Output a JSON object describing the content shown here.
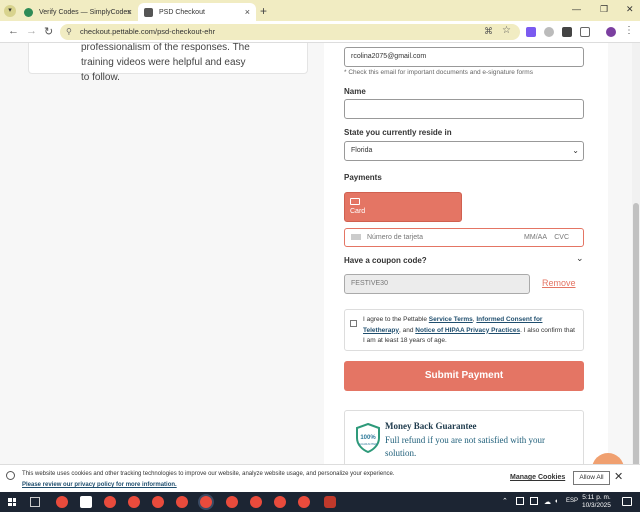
{
  "browser": {
    "tabs": [
      {
        "title": "Verify Codes — SimplyCodes",
        "favicon_color": "#2e8b57"
      },
      {
        "title": "PSD Checkout",
        "favicon_color": "#555555"
      }
    ],
    "url": "checkout.pettable.com/psd-checkout-ehr",
    "newtab_glyph": "+",
    "close_glyph": "×",
    "icons": [
      "back-icon",
      "forward-icon",
      "reload-icon",
      "translate-icon",
      "star-icon",
      "extensions-icon",
      "profile-icon",
      "menu-icon"
    ]
  },
  "review": {
    "text": "professionalism of the responses. The training videos were helpful and easy to follow."
  },
  "form": {
    "email_value": "rcolina2075@gmail.com",
    "email_note": "* Check this email for important documents and e-signature forms",
    "name_label": "Name",
    "name_value": "",
    "state_label": "State you currently reside in",
    "state_value": "Florida",
    "payments_label": "Payments",
    "card_label": "Card",
    "card_number_placeholder": "Número de tarjeta",
    "card_expiry_placeholder": "MM/AA",
    "card_cvc_placeholder": "CVC",
    "coupon_label": "Have a coupon code?",
    "coupon_value": "FESTIVE30",
    "remove_label": "Remove",
    "agree_prefix": "I agree to the Pettable",
    "agree_terms": "Service Terms",
    "agree_comma": ",",
    "agree_consent": "Informed Consent for Teletherapy",
    "agree_and": ", and",
    "agree_hipaa": "Notice of HIPAA Privacy Practices",
    "agree_suffix": ". I also confirm that I am at least 18 years of age.",
    "submit_label": "Submit Payment",
    "guarantee_title": "Money Back Guarantee",
    "guarantee_desc": "Full refund if you are not satisfied with your solution.",
    "guarantee_badge": "100%",
    "guarantee_badge_sub": "GUARANTEE"
  },
  "cookie": {
    "message": "This website uses cookies and other tracking technologies to improve our website, analyze website usage, and personalize your experience.",
    "policy_link": "Please review our privacy policy for more information.",
    "manage_label": "Manage Cookies",
    "allow_label": "Allow All"
  },
  "taskbar": {
    "language": "ESP",
    "time": "5:11 p. m.",
    "date": "10/3/2025"
  },
  "colors": {
    "accent": "#e47564",
    "tab_bar": "#f1ecc2",
    "link": "#1f4e6e"
  }
}
